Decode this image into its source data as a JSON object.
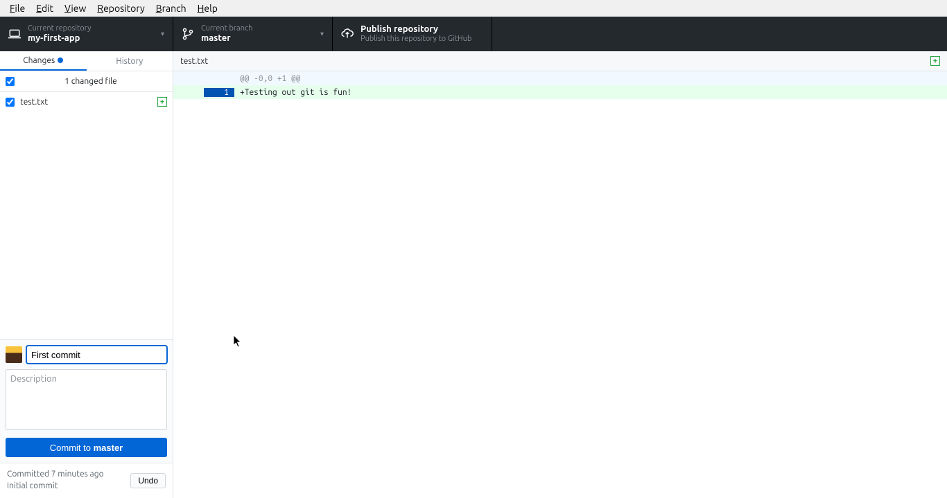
{
  "menubar": [
    "File",
    "Edit",
    "View",
    "Repository",
    "Branch",
    "Help"
  ],
  "toolbar": {
    "repo": {
      "label": "Current repository",
      "value": "my-first-app"
    },
    "branch": {
      "label": "Current branch",
      "value": "master"
    },
    "publish": {
      "title": "Publish repository",
      "subtitle": "Publish this repository to GitHub"
    }
  },
  "tabs": {
    "changes": "Changes",
    "history": "History"
  },
  "changes_header": "1 changed file",
  "files": [
    {
      "name": "test.txt",
      "status": "+"
    }
  ],
  "commit": {
    "summary_value": "First commit",
    "description_placeholder": "Description",
    "button_prefix": "Commit to ",
    "button_branch": "master"
  },
  "last_commit": {
    "line1": "Committed 7 minutes ago",
    "line2": "Initial commit",
    "undo": "Undo"
  },
  "diff": {
    "filename": "test.txt",
    "status": "+",
    "hunk": "@@ -0,0 +1 @@",
    "lines": [
      {
        "old": "",
        "new": "1",
        "text": "+Testing out git is fun!"
      }
    ]
  }
}
